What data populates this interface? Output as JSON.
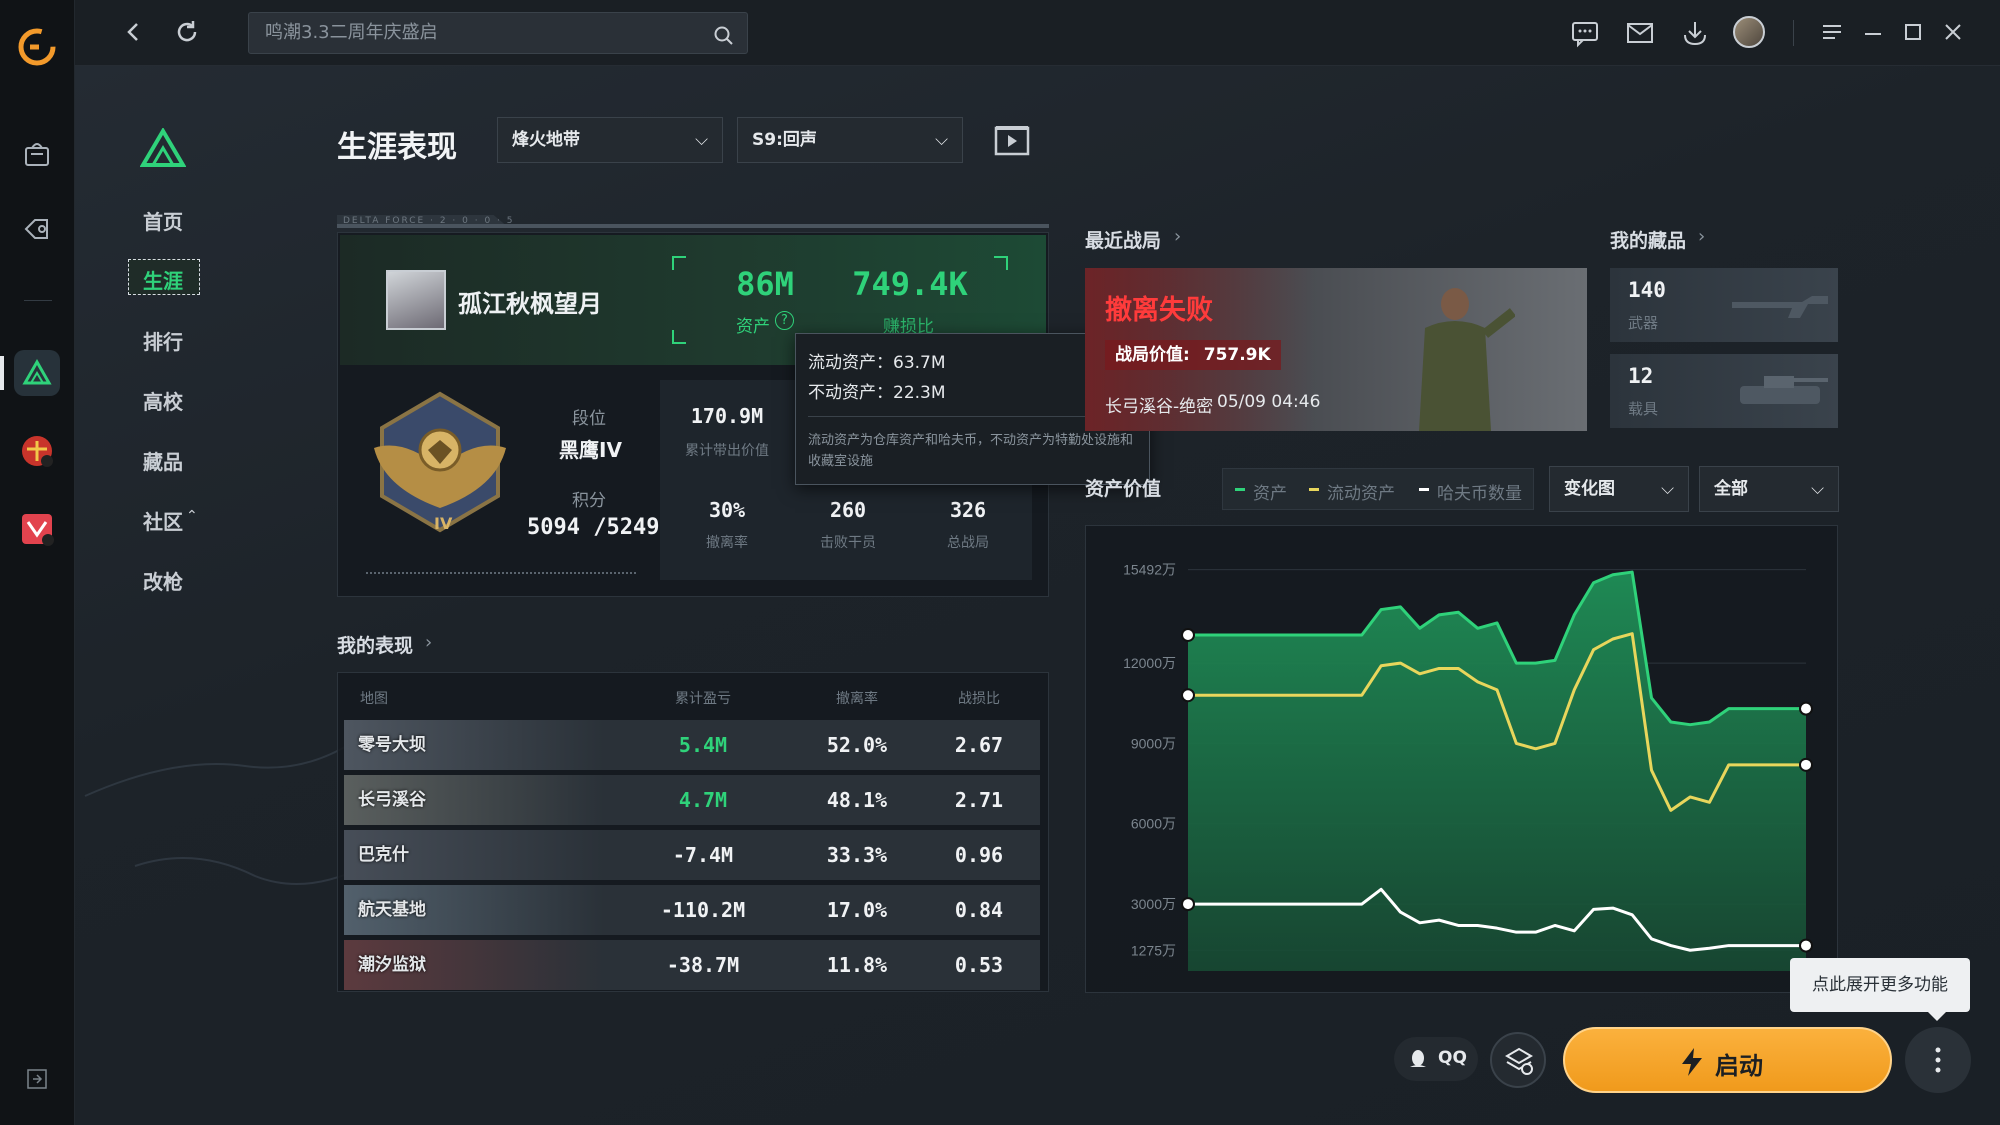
{
  "search": {
    "placeholder": "鸣潮3.3二周年庆盛启"
  },
  "nav": {
    "items": [
      {
        "label": "首页"
      },
      {
        "label": "生涯"
      },
      {
        "label": "排行"
      },
      {
        "label": "高校"
      },
      {
        "label": "藏品"
      },
      {
        "label": "社区"
      },
      {
        "label": "改枪"
      }
    ],
    "active_index": 1
  },
  "header": {
    "title": "生涯表现",
    "mode_select": "烽火地带",
    "season_select": "S9:回声"
  },
  "profile": {
    "banner_text": "DELTA FORCE · 2 · 0 · 0 · 5",
    "player_name": "孤江秋枫望月",
    "assets_value": "86M",
    "assets_label": "资产",
    "ratio_value": "749.4K",
    "ratio_label": "赚损比",
    "rank_label": "段位",
    "rank_value": "黑鹰IV",
    "rank_numeral": "IV",
    "points_label": "积分",
    "points_value": "5094 /5249",
    "stats": [
      {
        "value": "170.9M",
        "label": "累计带出价值"
      },
      {
        "value": "30%",
        "label": "撤离率"
      },
      {
        "value": "260",
        "label": "击败干员"
      },
      {
        "value": "326",
        "label": "总战局"
      }
    ]
  },
  "tooltip": {
    "line1": "流动资产：63.7M",
    "line2": "不动资产：22.3M",
    "note": "流动资产为仓库资产和哈夫币，不动资产为特勤处设施和收藏室设施"
  },
  "recent": {
    "title": "最近战局",
    "result": "撤离失败",
    "value_label": "战局价值:",
    "value": "757.9K",
    "map": "长弓溪谷-绝密",
    "time": "05/09 04:46"
  },
  "collection": {
    "title": "我的藏品",
    "items": [
      {
        "count": "140",
        "label": "武器"
      },
      {
        "count": "12",
        "label": "载具"
      }
    ]
  },
  "performance": {
    "title": "我的表现",
    "columns": [
      "地图",
      "累计盈亏",
      "撤离率",
      "战损比"
    ],
    "rows": [
      {
        "map": "零号大坝",
        "profit": "5.4M",
        "rate": "52.0%",
        "kd": "2.67",
        "positive": true
      },
      {
        "map": "长弓溪谷",
        "profit": "4.7M",
        "rate": "48.1%",
        "kd": "2.71",
        "positive": true
      },
      {
        "map": "巴克什",
        "profit": "-7.4M",
        "rate": "33.3%",
        "kd": "0.96",
        "positive": false
      },
      {
        "map": "航天基地",
        "profit": "-110.2M",
        "rate": "17.0%",
        "kd": "0.84",
        "positive": false
      },
      {
        "map": "潮汐监狱",
        "profit": "-38.7M",
        "rate": "11.8%",
        "kd": "0.53",
        "positive": false
      }
    ]
  },
  "asset_chart_header": {
    "title": "资产价值",
    "view_select": "变化图",
    "range_select": "全部"
  },
  "chart_data": {
    "type": "area",
    "title": "资产价值",
    "yticks": [
      "15492万",
      "12000万",
      "9000万",
      "6000万",
      "3000万",
      "1275万"
    ],
    "ytick_values": [
      15492,
      12000,
      9000,
      6000,
      3000,
      1275
    ],
    "ylim": [
      500,
      16000
    ],
    "x": [
      0,
      1,
      2,
      3,
      4,
      5,
      6,
      7,
      8,
      9,
      10,
      11,
      12,
      13,
      14,
      15,
      16,
      17,
      18,
      19,
      20,
      21,
      22,
      23,
      24,
      25,
      26,
      27,
      28,
      29,
      30,
      31,
      32
    ],
    "series": [
      {
        "name": "资产",
        "color": "#2fd27a",
        "values": [
          13050,
          13050,
          13050,
          13050,
          13050,
          13050,
          13050,
          13050,
          13050,
          13050,
          14000,
          14100,
          13300,
          13800,
          13900,
          13300,
          13500,
          12000,
          12000,
          12100,
          13800,
          15000,
          15300,
          15400,
          10700,
          9800,
          9700,
          9800,
          10300,
          10300,
          10300,
          10300,
          10300
        ]
      },
      {
        "name": "流动资产",
        "color": "#e8d65c",
        "values": [
          10800,
          10800,
          10800,
          10800,
          10800,
          10800,
          10800,
          10800,
          10800,
          10800,
          11900,
          12000,
          11600,
          11800,
          11800,
          11300,
          11000,
          9000,
          8800,
          9000,
          11000,
          12500,
          12900,
          13100,
          8000,
          6500,
          7000,
          6800,
          8200,
          8200,
          8200,
          8200,
          8200
        ]
      },
      {
        "name": "哈夫币数量",
        "color": "#ffffff",
        "values": [
          3000,
          3000,
          3000,
          3000,
          3000,
          3000,
          3000,
          3000,
          3000,
          3000,
          3550,
          2700,
          2300,
          2400,
          2200,
          2200,
          2100,
          1950,
          1950,
          2200,
          2000,
          2800,
          2850,
          2600,
          1700,
          1450,
          1275,
          1350,
          1450,
          1450,
          1450,
          1450,
          1450
        ]
      }
    ],
    "grid": true,
    "legend_position": "top"
  },
  "bottom": {
    "qq_label": "QQ",
    "launch_label": "启动",
    "tooltip_more": "点此展开更多功能"
  },
  "colors": {
    "accent": "#2fd27a",
    "launch": "#f5a623",
    "negative": "#ffffff"
  }
}
